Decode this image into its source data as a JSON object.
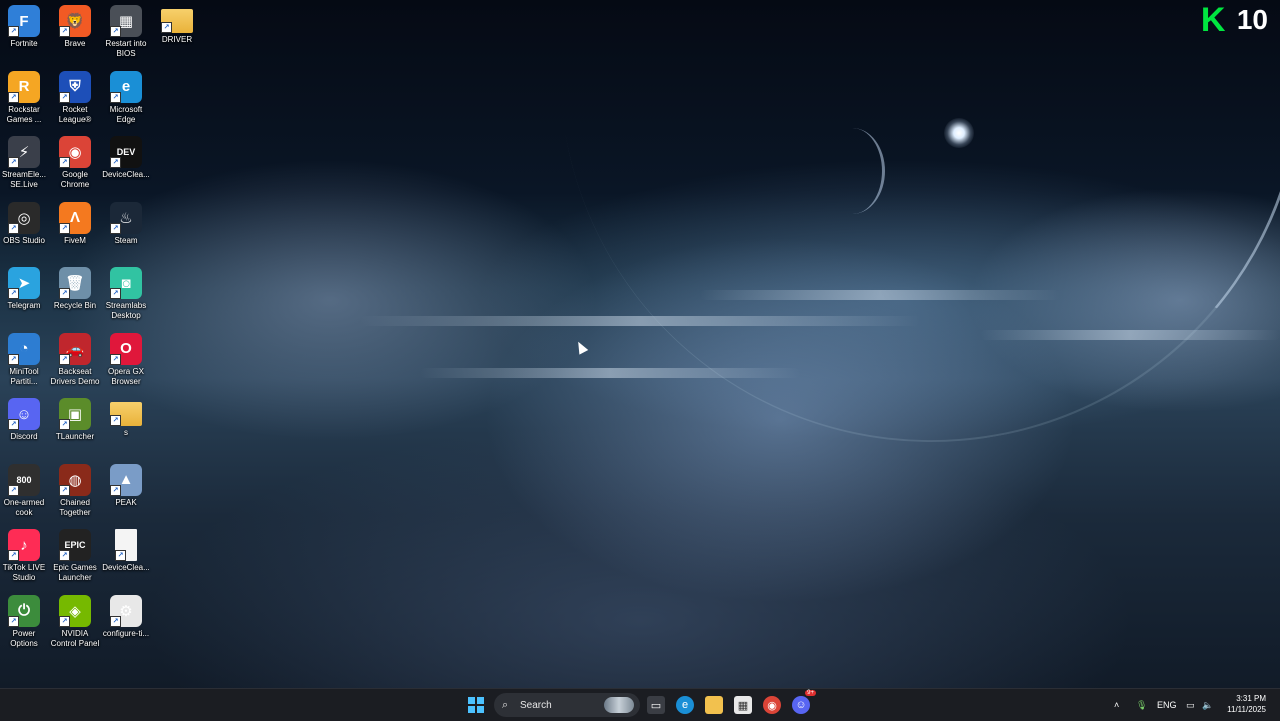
{
  "desktop": {
    "icons": [
      {
        "label": "Fortnite",
        "glyph": "F",
        "color": "#2f7fd8",
        "icon": "fortnite-icon"
      },
      {
        "label": "Brave",
        "glyph": "🦁",
        "color": "#f25a24",
        "icon": "brave-icon"
      },
      {
        "label": "Restart into BIOS",
        "glyph": "▦",
        "color": "#4a4f57",
        "icon": "chip-icon"
      },
      {
        "label": "DRIVER",
        "glyph": "",
        "color": "#f2c14e",
        "icon": "folder-icon"
      },
      {
        "label": "Rockstar Games ...",
        "glyph": "R",
        "color": "#f5a623",
        "icon": "rockstar-icon"
      },
      {
        "label": "Rocket League®",
        "glyph": "⛨",
        "color": "#1d4fb8",
        "icon": "rocket-league-icon"
      },
      {
        "label": "Microsoft Edge",
        "glyph": "e",
        "color": "#1a8fd6",
        "icon": "edge-icon"
      },
      {
        "label": "StreamEle... SE.Live",
        "glyph": "⚡",
        "color": "#3a3f4a",
        "icon": "streamelements-icon"
      },
      {
        "label": "Google Chrome",
        "glyph": "◉",
        "color": "#db4437",
        "icon": "chrome-icon"
      },
      {
        "label": "DeviceClea...",
        "glyph": "DEV",
        "color": "#111111",
        "icon": "devicecleanup-icon"
      },
      {
        "label": "OBS Studio",
        "glyph": "◎",
        "color": "#2a2a2a",
        "icon": "obs-icon"
      },
      {
        "label": "FiveM",
        "glyph": "Λ",
        "color": "#f4791f",
        "icon": "fivem-icon"
      },
      {
        "label": "Steam",
        "glyph": "♨",
        "color": "#1b2838",
        "icon": "steam-icon"
      },
      {
        "label": "Telegram",
        "glyph": "➤",
        "color": "#2aa3df",
        "icon": "telegram-icon"
      },
      {
        "label": "Recycle Bin",
        "glyph": "🗑",
        "color": "#6e8fa8",
        "icon": "recycle-bin-icon"
      },
      {
        "label": "Streamlabs Desktop",
        "glyph": "◙",
        "color": "#31c3a2",
        "icon": "streamlabs-icon"
      },
      {
        "label": "MiniTool Partiti...",
        "glyph": "◔",
        "color": "#2d7dd2",
        "icon": "minitool-icon"
      },
      {
        "label": "Backseat Drivers Demo",
        "glyph": "🚗",
        "color": "#c0262d",
        "icon": "car-icon"
      },
      {
        "label": "Opera GX Browser",
        "glyph": "O",
        "color": "#e0173b",
        "icon": "opera-gx-icon"
      },
      {
        "label": "Discord",
        "glyph": "☺",
        "color": "#5865f2",
        "icon": "discord-icon"
      },
      {
        "label": "TLauncher",
        "glyph": "▣",
        "color": "#5b8c2a",
        "icon": "tlauncher-icon"
      },
      {
        "label": "s",
        "glyph": "",
        "color": "#f2c14e",
        "icon": "folder-icon"
      },
      {
        "label": "One-armed cook",
        "glyph": "800",
        "color": "#2f2f2f",
        "icon": "one-armed-cook-icon"
      },
      {
        "label": "Chained Together",
        "glyph": "◍",
        "color": "#8a2a1a",
        "icon": "chained-together-icon"
      },
      {
        "label": "PEAK",
        "glyph": "▲",
        "color": "#7a9cc7",
        "icon": "peak-icon"
      },
      {
        "label": "TikTok LIVE Studio",
        "glyph": "♪",
        "color": "#fe2c55",
        "icon": "tiktok-icon"
      },
      {
        "label": "Epic Games Launcher",
        "glyph": "EPIC",
        "color": "#222222",
        "icon": "epic-games-icon"
      },
      {
        "label": "DeviceClea...",
        "glyph": "",
        "color": "#f4f4f4",
        "icon": "document-icon"
      },
      {
        "label": "Power Options",
        "glyph": "⏻",
        "color": "#3c8c3c",
        "icon": "power-icon"
      },
      {
        "label": "NVIDIA Control Panel",
        "glyph": "◈",
        "color": "#76b900",
        "icon": "nvidia-icon"
      },
      {
        "label": "configure-ti...",
        "glyph": "⚙",
        "color": "#e8e8e8",
        "icon": "settings-file-icon"
      }
    ]
  },
  "badge": {
    "letter": "K",
    "number": "10"
  },
  "taskbar": {
    "search_placeholder": "Search",
    "tray_language": "ENG",
    "time": "3:31 PM",
    "date": "11/11/2025",
    "notification_count": "9+"
  }
}
